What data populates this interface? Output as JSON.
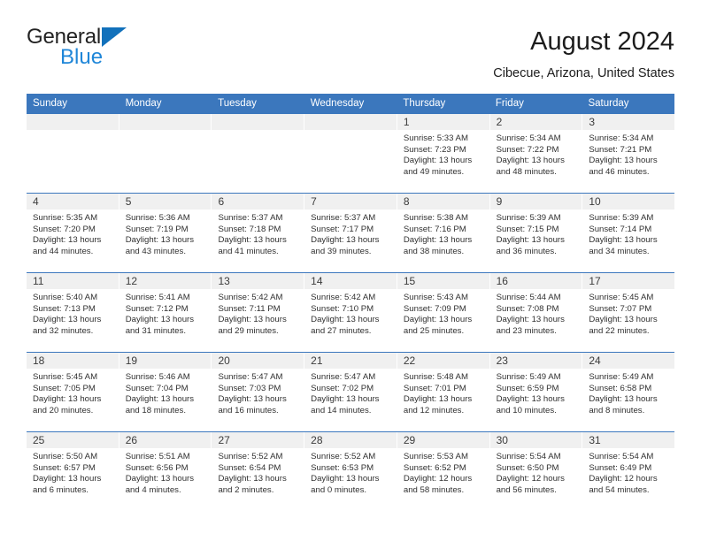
{
  "brand": {
    "name_part1": "General",
    "name_part2": "Blue",
    "triangle_color": "#1271bb",
    "blue_color": "#1f86d8"
  },
  "header": {
    "title": "August 2024",
    "subtitle": "Cibecue, Arizona, United States"
  },
  "theme": {
    "header_blue": "#3b77bd",
    "day_band_gray": "#f0f0f0",
    "text_color": "#303030"
  },
  "calendar": {
    "weekdays": [
      "Sunday",
      "Monday",
      "Tuesday",
      "Wednesday",
      "Thursday",
      "Friday",
      "Saturday"
    ],
    "labels": {
      "sunrise": "Sunrise:",
      "sunset": "Sunset:",
      "daylight": "Daylight:"
    },
    "weeks": [
      [
        {
          "day": "",
          "empty": true
        },
        {
          "day": "",
          "empty": true
        },
        {
          "day": "",
          "empty": true
        },
        {
          "day": "",
          "empty": true
        },
        {
          "day": "1",
          "sunrise": "Sunrise: 5:33 AM",
          "sunset": "Sunset: 7:23 PM",
          "daylight": "Daylight: 13 hours and 49 minutes."
        },
        {
          "day": "2",
          "sunrise": "Sunrise: 5:34 AM",
          "sunset": "Sunset: 7:22 PM",
          "daylight": "Daylight: 13 hours and 48 minutes."
        },
        {
          "day": "3",
          "sunrise": "Sunrise: 5:34 AM",
          "sunset": "Sunset: 7:21 PM",
          "daylight": "Daylight: 13 hours and 46 minutes."
        }
      ],
      [
        {
          "day": "4",
          "sunrise": "Sunrise: 5:35 AM",
          "sunset": "Sunset: 7:20 PM",
          "daylight": "Daylight: 13 hours and 44 minutes."
        },
        {
          "day": "5",
          "sunrise": "Sunrise: 5:36 AM",
          "sunset": "Sunset: 7:19 PM",
          "daylight": "Daylight: 13 hours and 43 minutes."
        },
        {
          "day": "6",
          "sunrise": "Sunrise: 5:37 AM",
          "sunset": "Sunset: 7:18 PM",
          "daylight": "Daylight: 13 hours and 41 minutes."
        },
        {
          "day": "7",
          "sunrise": "Sunrise: 5:37 AM",
          "sunset": "Sunset: 7:17 PM",
          "daylight": "Daylight: 13 hours and 39 minutes."
        },
        {
          "day": "8",
          "sunrise": "Sunrise: 5:38 AM",
          "sunset": "Sunset: 7:16 PM",
          "daylight": "Daylight: 13 hours and 38 minutes."
        },
        {
          "day": "9",
          "sunrise": "Sunrise: 5:39 AM",
          "sunset": "Sunset: 7:15 PM",
          "daylight": "Daylight: 13 hours and 36 minutes."
        },
        {
          "day": "10",
          "sunrise": "Sunrise: 5:39 AM",
          "sunset": "Sunset: 7:14 PM",
          "daylight": "Daylight: 13 hours and 34 minutes."
        }
      ],
      [
        {
          "day": "11",
          "sunrise": "Sunrise: 5:40 AM",
          "sunset": "Sunset: 7:13 PM",
          "daylight": "Daylight: 13 hours and 32 minutes."
        },
        {
          "day": "12",
          "sunrise": "Sunrise: 5:41 AM",
          "sunset": "Sunset: 7:12 PM",
          "daylight": "Daylight: 13 hours and 31 minutes."
        },
        {
          "day": "13",
          "sunrise": "Sunrise: 5:42 AM",
          "sunset": "Sunset: 7:11 PM",
          "daylight": "Daylight: 13 hours and 29 minutes."
        },
        {
          "day": "14",
          "sunrise": "Sunrise: 5:42 AM",
          "sunset": "Sunset: 7:10 PM",
          "daylight": "Daylight: 13 hours and 27 minutes."
        },
        {
          "day": "15",
          "sunrise": "Sunrise: 5:43 AM",
          "sunset": "Sunset: 7:09 PM",
          "daylight": "Daylight: 13 hours and 25 minutes."
        },
        {
          "day": "16",
          "sunrise": "Sunrise: 5:44 AM",
          "sunset": "Sunset: 7:08 PM",
          "daylight": "Daylight: 13 hours and 23 minutes."
        },
        {
          "day": "17",
          "sunrise": "Sunrise: 5:45 AM",
          "sunset": "Sunset: 7:07 PM",
          "daylight": "Daylight: 13 hours and 22 minutes."
        }
      ],
      [
        {
          "day": "18",
          "sunrise": "Sunrise: 5:45 AM",
          "sunset": "Sunset: 7:05 PM",
          "daylight": "Daylight: 13 hours and 20 minutes."
        },
        {
          "day": "19",
          "sunrise": "Sunrise: 5:46 AM",
          "sunset": "Sunset: 7:04 PM",
          "daylight": "Daylight: 13 hours and 18 minutes."
        },
        {
          "day": "20",
          "sunrise": "Sunrise: 5:47 AM",
          "sunset": "Sunset: 7:03 PM",
          "daylight": "Daylight: 13 hours and 16 minutes."
        },
        {
          "day": "21",
          "sunrise": "Sunrise: 5:47 AM",
          "sunset": "Sunset: 7:02 PM",
          "daylight": "Daylight: 13 hours and 14 minutes."
        },
        {
          "day": "22",
          "sunrise": "Sunrise: 5:48 AM",
          "sunset": "Sunset: 7:01 PM",
          "daylight": "Daylight: 13 hours and 12 minutes."
        },
        {
          "day": "23",
          "sunrise": "Sunrise: 5:49 AM",
          "sunset": "Sunset: 6:59 PM",
          "daylight": "Daylight: 13 hours and 10 minutes."
        },
        {
          "day": "24",
          "sunrise": "Sunrise: 5:49 AM",
          "sunset": "Sunset: 6:58 PM",
          "daylight": "Daylight: 13 hours and 8 minutes."
        }
      ],
      [
        {
          "day": "25",
          "sunrise": "Sunrise: 5:50 AM",
          "sunset": "Sunset: 6:57 PM",
          "daylight": "Daylight: 13 hours and 6 minutes."
        },
        {
          "day": "26",
          "sunrise": "Sunrise: 5:51 AM",
          "sunset": "Sunset: 6:56 PM",
          "daylight": "Daylight: 13 hours and 4 minutes."
        },
        {
          "day": "27",
          "sunrise": "Sunrise: 5:52 AM",
          "sunset": "Sunset: 6:54 PM",
          "daylight": "Daylight: 13 hours and 2 minutes."
        },
        {
          "day": "28",
          "sunrise": "Sunrise: 5:52 AM",
          "sunset": "Sunset: 6:53 PM",
          "daylight": "Daylight: 13 hours and 0 minutes."
        },
        {
          "day": "29",
          "sunrise": "Sunrise: 5:53 AM",
          "sunset": "Sunset: 6:52 PM",
          "daylight": "Daylight: 12 hours and 58 minutes."
        },
        {
          "day": "30",
          "sunrise": "Sunrise: 5:54 AM",
          "sunset": "Sunset: 6:50 PM",
          "daylight": "Daylight: 12 hours and 56 minutes."
        },
        {
          "day": "31",
          "sunrise": "Sunrise: 5:54 AM",
          "sunset": "Sunset: 6:49 PM",
          "daylight": "Daylight: 12 hours and 54 minutes."
        }
      ]
    ]
  }
}
